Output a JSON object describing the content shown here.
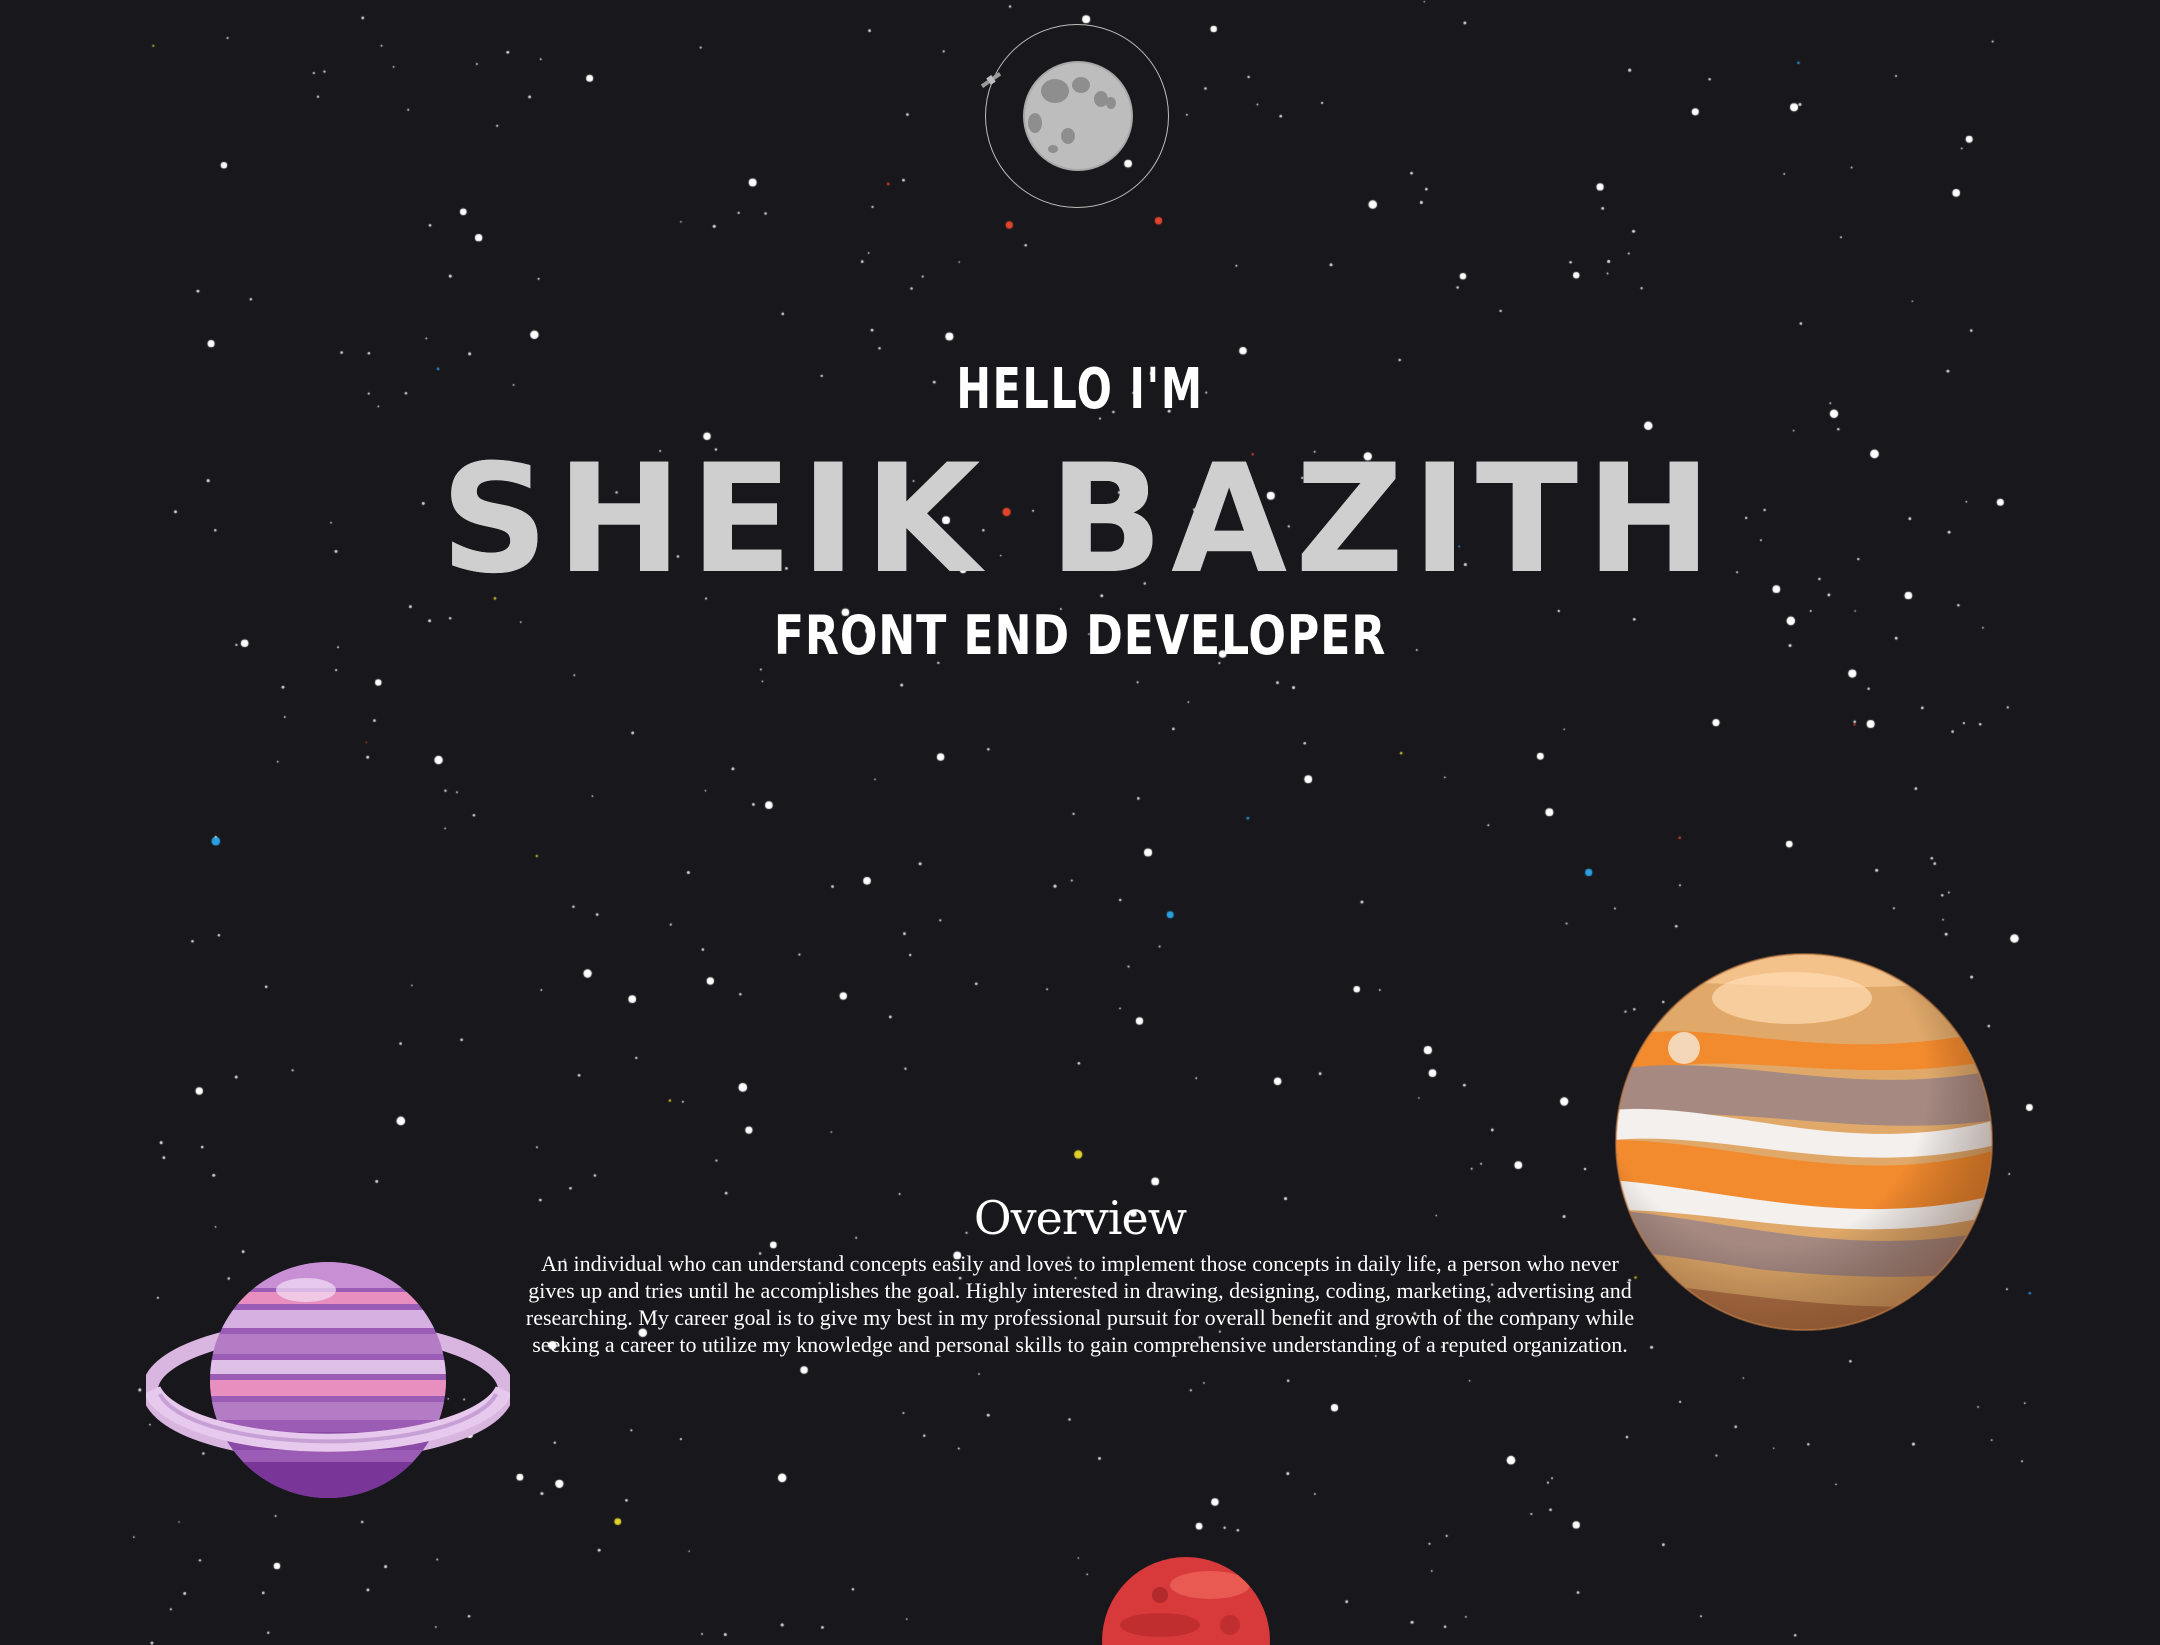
{
  "hero": {
    "greeting": "HELLO I'M",
    "name": "SHEIK BAZITH",
    "role": "FRONT END DEVELOPER"
  },
  "overview": {
    "title": "Overview",
    "text": "An individual who can understand concepts easily and loves to implement those concepts in daily life, a person who never gives up and tries until he accomplishes the goal. Highly interested in drawing, designing, coding, marketing, advertising and researching. My career goal is to give my best in my professional pursuit for overall benefit and growth of the company while seeking a career to utilize my knowledge and personal skills to gain comprehensive understanding of a reputed organization."
  },
  "decor": {
    "icons": [
      "moon-icon",
      "satellite-icon",
      "jupiter-planet-icon",
      "saturn-planet-icon",
      "mars-planet-icon",
      "starfield"
    ],
    "colors": {
      "background": "#18181c",
      "name_text": "#cfcfcf",
      "text": "#ffffff",
      "jupiter_orange": "#f28a2e",
      "saturn_purple": "#9b5cb5",
      "mars_red": "#d8393a"
    }
  }
}
